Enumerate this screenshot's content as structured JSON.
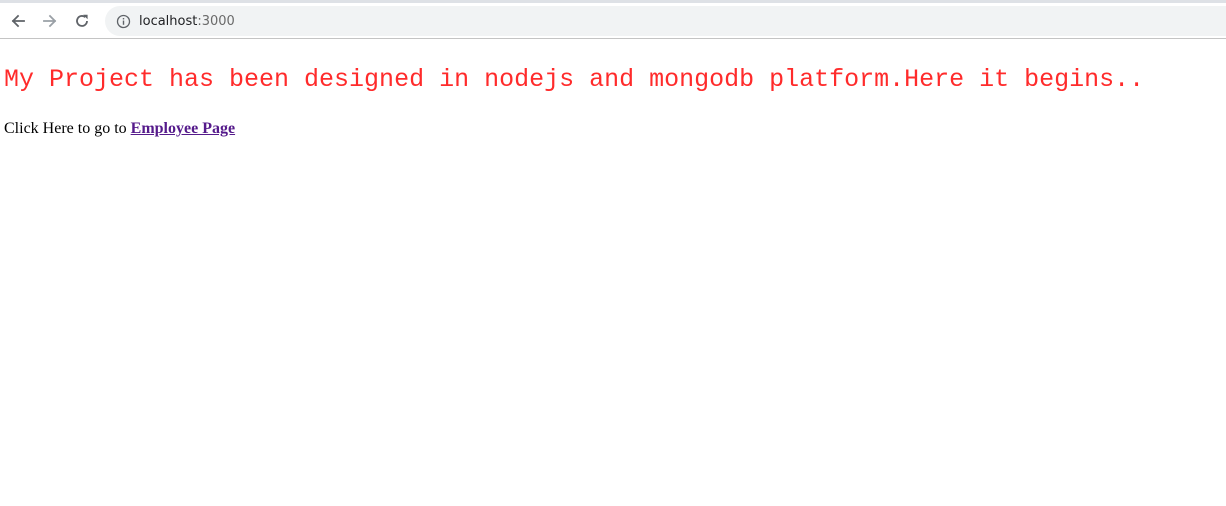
{
  "browser": {
    "url_host": "localhost",
    "url_port": ":3000",
    "icons": {
      "back": "back-arrow-icon",
      "forward": "forward-arrow-icon",
      "reload": "reload-icon",
      "site_info": "info-icon"
    }
  },
  "page": {
    "headline": "My Project has been designed in nodejs and mongodb platform.Here it begins..",
    "link_prefix": "Click Here to go to ",
    "link_text": "Employee Page"
  },
  "colors": {
    "headline": "#ff2b2b",
    "visited_link": "#551a8b"
  }
}
